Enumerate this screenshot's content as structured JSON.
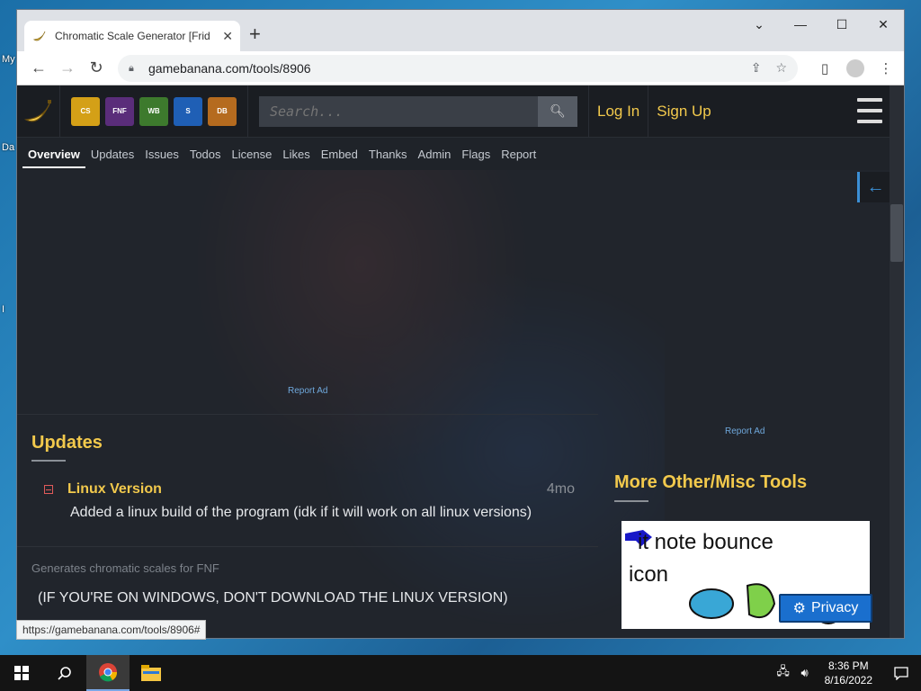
{
  "desktop": {
    "labels": [
      "My",
      "Da",
      "I"
    ]
  },
  "browser": {
    "tab_title": "Chromatic Scale Generator [Frid",
    "url": "gamebanana.com/tools/8906",
    "status_url": "https://gamebanana.com/tools/8906#"
  },
  "site": {
    "search_placeholder": "Search...",
    "login": "Log In",
    "signup": "Sign Up",
    "game_icons": [
      {
        "name": "counter-strike-icon",
        "color": "#d4a017"
      },
      {
        "name": "friday-night-funkin-icon",
        "color": "#5a2d7a"
      },
      {
        "name": "worldbox-icon",
        "color": "#3d7a2d"
      },
      {
        "name": "sonic-icon",
        "color": "#1f5fb5"
      },
      {
        "name": "dragonball-icon",
        "color": "#b56b1f"
      }
    ],
    "subnav": [
      "Overview",
      "Updates",
      "Issues",
      "Todos",
      "License",
      "Likes",
      "Embed",
      "Thanks",
      "Admin",
      "Flags",
      "Report"
    ],
    "report_ad": "Report Ad"
  },
  "updates": {
    "title": "Updates",
    "items": [
      {
        "title": "Linux Version",
        "age": "4mo",
        "desc": "Added a linux build of the program (idk if it will work on all linux versions)"
      }
    ]
  },
  "description": {
    "summary": "Generates chromatic scales for FNF",
    "body": "(IF YOU'RE ON WINDOWS, DON'T DOWNLOAD THE LINUX VERSION)"
  },
  "sidebar": {
    "more_title": "More Other/Misc Tools",
    "card_line1": "it note bounce",
    "card_line2": "icon"
  },
  "privacy": {
    "label": "Privacy"
  },
  "taskbar": {
    "time": "8:36 PM",
    "date": "8/16/2022"
  },
  "colors": {
    "accent": "#f2c94c",
    "link": "#6fa8dc",
    "privacy": "#1a6fce"
  }
}
